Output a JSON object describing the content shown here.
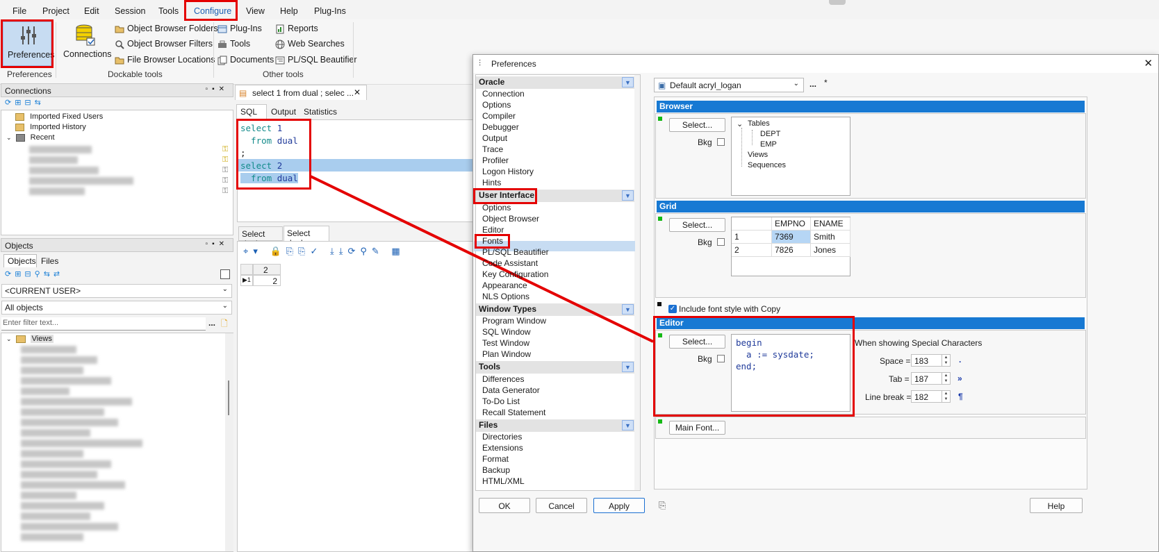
{
  "menubar": {
    "items": [
      "File",
      "Project",
      "Edit",
      "Session",
      "Tools",
      "Configure",
      "View",
      "Help",
      "Plug-Ins"
    ]
  },
  "ribbon": {
    "preferences": "Preferences",
    "connections": "Connections",
    "obj_browser_folders": "Object Browser Folders",
    "obj_browser_filters": "Object Browser Filters",
    "file_browser_locations": "File Browser Locations",
    "plugins": "Plug-Ins",
    "tools": "Tools",
    "documents": "Documents",
    "reports": "Reports",
    "web_searches": "Web Searches",
    "plsql_beautifier": "PL/SQL Beautifier",
    "group_preferences": "Preferences",
    "group_dockable": "Dockable tools",
    "group_other": "Other tools"
  },
  "connections_panel": {
    "title": "Connections",
    "items": [
      "Imported Fixed Users",
      "Imported History",
      "Recent"
    ]
  },
  "objects_panel": {
    "title": "Objects",
    "tabs": [
      "Objects",
      "Files"
    ],
    "user_select": "<CURRENT USER>",
    "filter_select": "All objects",
    "filter_placeholder": "Enter filter text...",
    "tree_root": "Views"
  },
  "sql_window": {
    "tab_title": "select 1 from dual ; selec ...",
    "subtabs": [
      "SQL",
      "Output",
      "Statistics"
    ],
    "code_lines": [
      "select 1",
      "  from dual",
      ";",
      "select 2",
      "  from dual"
    ],
    "result_tabs": [
      "Select dual",
      "Select dual"
    ],
    "result_header": "2",
    "result_row_num": "1",
    "result_value": "2"
  },
  "dialog": {
    "title": "Preferences",
    "profile": "Default acryl_logan",
    "profile_more": "...",
    "profile_modified": "*",
    "categories": [
      {
        "name": "Oracle",
        "items": [
          "Connection",
          "Options",
          "Compiler",
          "Debugger",
          "Output",
          "Trace",
          "Profiler",
          "Logon History",
          "Hints"
        ]
      },
      {
        "name": "User Interface",
        "items": [
          "Options",
          "Object Browser",
          "Editor",
          "Fonts",
          "PL/SQL Beautifier",
          "Code Assistant",
          "Key Configuration",
          "Appearance",
          "NLS Options"
        ]
      },
      {
        "name": "Window Types",
        "items": [
          "Program Window",
          "SQL Window",
          "Test Window",
          "Plan Window"
        ]
      },
      {
        "name": "Tools",
        "items": [
          "Differences",
          "Data Generator",
          "To-Do List",
          "Recall Statement"
        ]
      },
      {
        "name": "Files",
        "items": [
          "Directories",
          "Extensions",
          "Format",
          "Backup",
          "HTML/XML"
        ]
      }
    ],
    "browser": {
      "title": "Browser",
      "select": "Select...",
      "bkg": "Bkg",
      "tree": [
        "Tables",
        "DEPT",
        "EMP",
        "Views",
        "Sequences"
      ]
    },
    "grid": {
      "title": "Grid",
      "select": "Select...",
      "bkg": "Bkg",
      "columns": [
        "EMPNO",
        "ENAME"
      ],
      "rows": [
        [
          "1",
          "7369",
          "Smith"
        ],
        [
          "2",
          "7826",
          "Jones"
        ]
      ]
    },
    "include_font_style": "Include font style with Copy",
    "editor": {
      "title": "Editor",
      "select": "Select...",
      "bkg": "Bkg",
      "code": [
        "begin",
        "  a := sysdate;",
        "end;"
      ],
      "special_chars_label": "When showing Special Characters",
      "space_label": "Space =",
      "space_value": "183",
      "space_glyph": ".",
      "tab_label": "Tab =",
      "tab_value": "187",
      "tab_glyph": "»",
      "linebreak_label": "Line break =",
      "linebreak_value": "182",
      "linebreak_glyph": "¶"
    },
    "main_font": "Main Font...",
    "buttons": {
      "ok": "OK",
      "cancel": "Cancel",
      "apply": "Apply",
      "help": "Help"
    }
  },
  "colors": {
    "accent_blue": "#1779d3",
    "highlight_red": "#e40000",
    "selection": "#c7dcf2"
  }
}
